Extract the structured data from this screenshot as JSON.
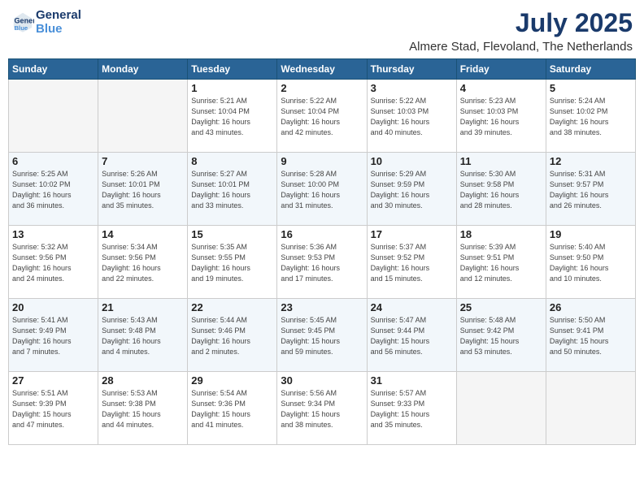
{
  "header": {
    "logo_line1": "General",
    "logo_line2": "Blue",
    "month": "July 2025",
    "location": "Almere Stad, Flevoland, The Netherlands"
  },
  "days_of_week": [
    "Sunday",
    "Monday",
    "Tuesday",
    "Wednesday",
    "Thursday",
    "Friday",
    "Saturday"
  ],
  "weeks": [
    [
      {
        "num": "",
        "detail": ""
      },
      {
        "num": "",
        "detail": ""
      },
      {
        "num": "1",
        "detail": "Sunrise: 5:21 AM\nSunset: 10:04 PM\nDaylight: 16 hours\nand 43 minutes."
      },
      {
        "num": "2",
        "detail": "Sunrise: 5:22 AM\nSunset: 10:04 PM\nDaylight: 16 hours\nand 42 minutes."
      },
      {
        "num": "3",
        "detail": "Sunrise: 5:22 AM\nSunset: 10:03 PM\nDaylight: 16 hours\nand 40 minutes."
      },
      {
        "num": "4",
        "detail": "Sunrise: 5:23 AM\nSunset: 10:03 PM\nDaylight: 16 hours\nand 39 minutes."
      },
      {
        "num": "5",
        "detail": "Sunrise: 5:24 AM\nSunset: 10:02 PM\nDaylight: 16 hours\nand 38 minutes."
      }
    ],
    [
      {
        "num": "6",
        "detail": "Sunrise: 5:25 AM\nSunset: 10:02 PM\nDaylight: 16 hours\nand 36 minutes."
      },
      {
        "num": "7",
        "detail": "Sunrise: 5:26 AM\nSunset: 10:01 PM\nDaylight: 16 hours\nand 35 minutes."
      },
      {
        "num": "8",
        "detail": "Sunrise: 5:27 AM\nSunset: 10:01 PM\nDaylight: 16 hours\nand 33 minutes."
      },
      {
        "num": "9",
        "detail": "Sunrise: 5:28 AM\nSunset: 10:00 PM\nDaylight: 16 hours\nand 31 minutes."
      },
      {
        "num": "10",
        "detail": "Sunrise: 5:29 AM\nSunset: 9:59 PM\nDaylight: 16 hours\nand 30 minutes."
      },
      {
        "num": "11",
        "detail": "Sunrise: 5:30 AM\nSunset: 9:58 PM\nDaylight: 16 hours\nand 28 minutes."
      },
      {
        "num": "12",
        "detail": "Sunrise: 5:31 AM\nSunset: 9:57 PM\nDaylight: 16 hours\nand 26 minutes."
      }
    ],
    [
      {
        "num": "13",
        "detail": "Sunrise: 5:32 AM\nSunset: 9:56 PM\nDaylight: 16 hours\nand 24 minutes."
      },
      {
        "num": "14",
        "detail": "Sunrise: 5:34 AM\nSunset: 9:56 PM\nDaylight: 16 hours\nand 22 minutes."
      },
      {
        "num": "15",
        "detail": "Sunrise: 5:35 AM\nSunset: 9:55 PM\nDaylight: 16 hours\nand 19 minutes."
      },
      {
        "num": "16",
        "detail": "Sunrise: 5:36 AM\nSunset: 9:53 PM\nDaylight: 16 hours\nand 17 minutes."
      },
      {
        "num": "17",
        "detail": "Sunrise: 5:37 AM\nSunset: 9:52 PM\nDaylight: 16 hours\nand 15 minutes."
      },
      {
        "num": "18",
        "detail": "Sunrise: 5:39 AM\nSunset: 9:51 PM\nDaylight: 16 hours\nand 12 minutes."
      },
      {
        "num": "19",
        "detail": "Sunrise: 5:40 AM\nSunset: 9:50 PM\nDaylight: 16 hours\nand 10 minutes."
      }
    ],
    [
      {
        "num": "20",
        "detail": "Sunrise: 5:41 AM\nSunset: 9:49 PM\nDaylight: 16 hours\nand 7 minutes."
      },
      {
        "num": "21",
        "detail": "Sunrise: 5:43 AM\nSunset: 9:48 PM\nDaylight: 16 hours\nand 4 minutes."
      },
      {
        "num": "22",
        "detail": "Sunrise: 5:44 AM\nSunset: 9:46 PM\nDaylight: 16 hours\nand 2 minutes."
      },
      {
        "num": "23",
        "detail": "Sunrise: 5:45 AM\nSunset: 9:45 PM\nDaylight: 15 hours\nand 59 minutes."
      },
      {
        "num": "24",
        "detail": "Sunrise: 5:47 AM\nSunset: 9:44 PM\nDaylight: 15 hours\nand 56 minutes."
      },
      {
        "num": "25",
        "detail": "Sunrise: 5:48 AM\nSunset: 9:42 PM\nDaylight: 15 hours\nand 53 minutes."
      },
      {
        "num": "26",
        "detail": "Sunrise: 5:50 AM\nSunset: 9:41 PM\nDaylight: 15 hours\nand 50 minutes."
      }
    ],
    [
      {
        "num": "27",
        "detail": "Sunrise: 5:51 AM\nSunset: 9:39 PM\nDaylight: 15 hours\nand 47 minutes."
      },
      {
        "num": "28",
        "detail": "Sunrise: 5:53 AM\nSunset: 9:38 PM\nDaylight: 15 hours\nand 44 minutes."
      },
      {
        "num": "29",
        "detail": "Sunrise: 5:54 AM\nSunset: 9:36 PM\nDaylight: 15 hours\nand 41 minutes."
      },
      {
        "num": "30",
        "detail": "Sunrise: 5:56 AM\nSunset: 9:34 PM\nDaylight: 15 hours\nand 38 minutes."
      },
      {
        "num": "31",
        "detail": "Sunrise: 5:57 AM\nSunset: 9:33 PM\nDaylight: 15 hours\nand 35 minutes."
      },
      {
        "num": "",
        "detail": ""
      },
      {
        "num": "",
        "detail": ""
      }
    ]
  ]
}
